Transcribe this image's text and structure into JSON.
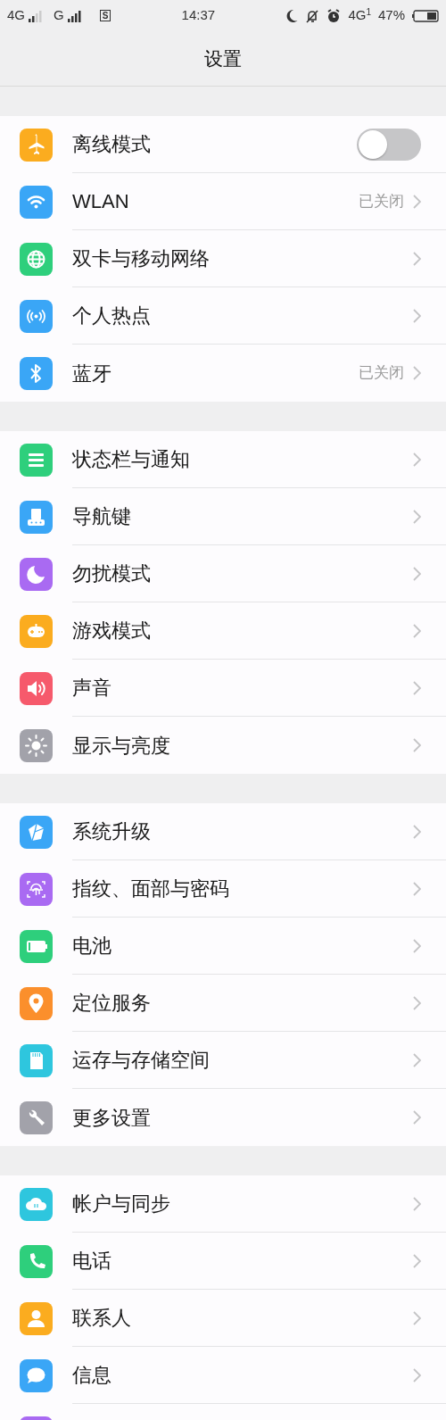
{
  "status_bar": {
    "sim1": "4G",
    "sim2": "G",
    "sim_badge": "S",
    "time": "14:37",
    "network": "4G",
    "network_sub": "1",
    "battery": "47%"
  },
  "header": {
    "title": "设置"
  },
  "groups": [
    {
      "items": [
        {
          "label": "离线模式",
          "color": "#fbac1f",
          "kind": "toggle",
          "on": false
        },
        {
          "label": "WLAN",
          "color": "#3aa6f6",
          "kind": "link",
          "value": "已关闭"
        },
        {
          "label": "双卡与移动网络",
          "color": "#2ecf7c",
          "kind": "link"
        },
        {
          "label": "个人热点",
          "color": "#3aa6f6",
          "kind": "link"
        },
        {
          "label": "蓝牙",
          "color": "#3aa6f6",
          "kind": "link",
          "value": "已关闭"
        }
      ]
    },
    {
      "items": [
        {
          "label": "状态栏与通知",
          "color": "#2ecf7c",
          "kind": "link"
        },
        {
          "label": "导航键",
          "color": "#3aa6f6",
          "kind": "link"
        },
        {
          "label": "勿扰模式",
          "color": "#a96af2",
          "kind": "link"
        },
        {
          "label": "游戏模式",
          "color": "#fbac1f",
          "kind": "link"
        },
        {
          "label": "声音",
          "color": "#f65a6c",
          "kind": "link"
        },
        {
          "label": "显示与亮度",
          "color": "#a2a2aa",
          "kind": "link"
        }
      ]
    },
    {
      "items": [
        {
          "label": "系统升级",
          "color": "#3aa6f6",
          "kind": "link"
        },
        {
          "label": "指纹、面部与密码",
          "color": "#a96af2",
          "kind": "link"
        },
        {
          "label": "电池",
          "color": "#2ecf7c",
          "kind": "link"
        },
        {
          "label": "定位服务",
          "color": "#fb8f2c",
          "kind": "link"
        },
        {
          "label": "运存与存储空间",
          "color": "#2ec6de",
          "kind": "link"
        },
        {
          "label": "更多设置",
          "color": "#a2a2aa",
          "kind": "link"
        }
      ]
    },
    {
      "items": [
        {
          "label": "帐户与同步",
          "color": "#2ec6de",
          "kind": "link"
        },
        {
          "label": "电话",
          "color": "#2ecf7c",
          "kind": "link"
        },
        {
          "label": "联系人",
          "color": "#fbac1f",
          "kind": "link"
        },
        {
          "label": "信息",
          "color": "#3aa6f6",
          "kind": "link"
        },
        {
          "color": "#a96af2",
          "kind": "partial"
        }
      ]
    }
  ]
}
